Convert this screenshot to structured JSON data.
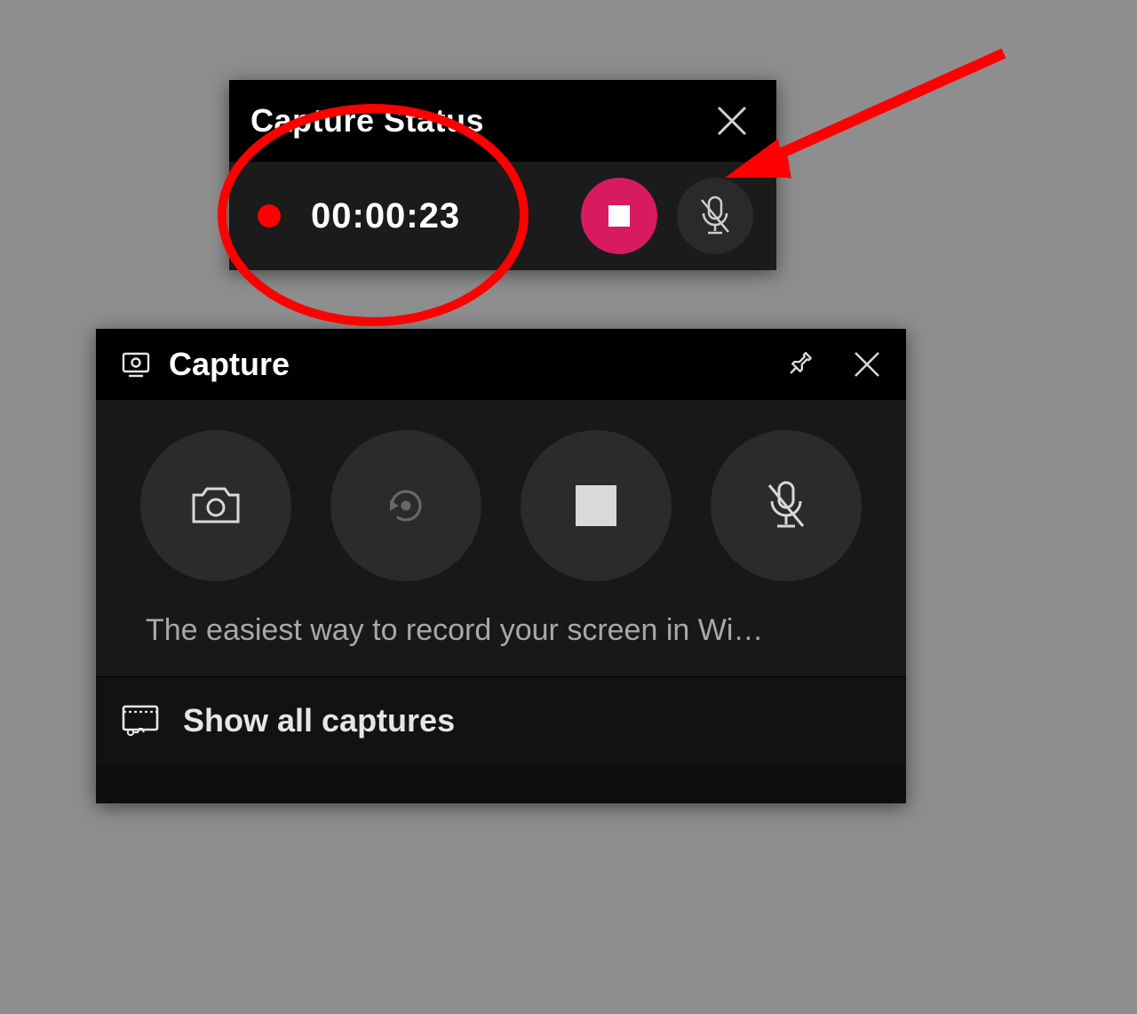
{
  "status": {
    "title": "Capture Status",
    "time": "00:00:23"
  },
  "capture": {
    "title": "Capture",
    "hint": "The easiest way to record your screen in Wi…",
    "show_all": "Show all captures"
  },
  "colors": {
    "stop_button": "#d81b60",
    "annotation": "#ff0000"
  },
  "icons": {
    "record_dot": "record-dot",
    "stop": "stop",
    "mic_muted": "mic-muted",
    "close": "close",
    "pin": "pin",
    "camera": "camera",
    "record_last": "record-last",
    "capture_monitor": "capture-monitor",
    "gallery": "gallery"
  }
}
